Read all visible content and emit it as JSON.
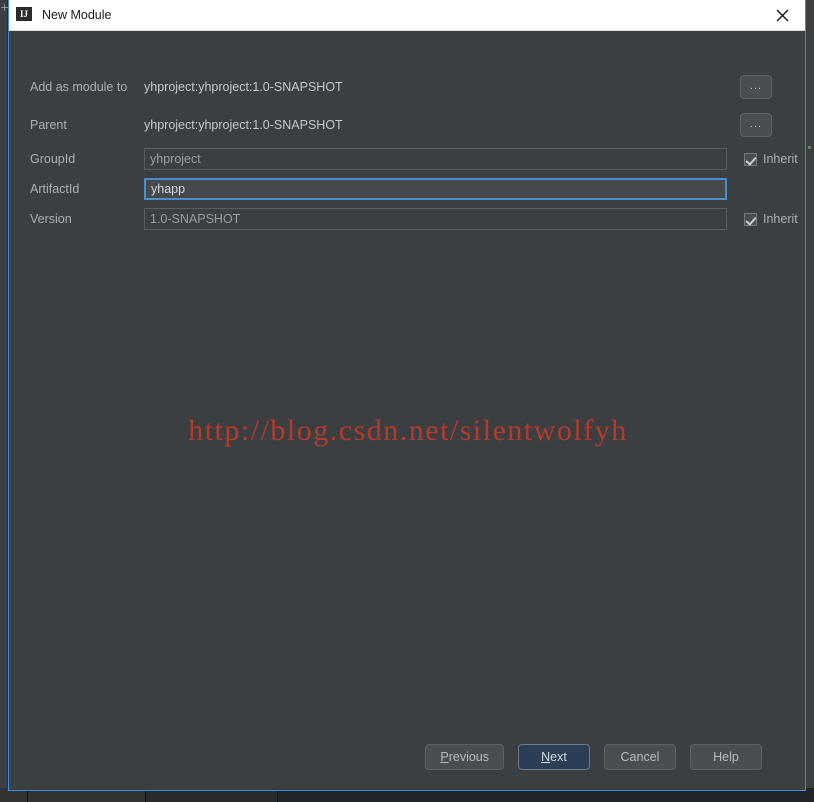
{
  "window": {
    "title": "New Module",
    "app_icon": "IJ",
    "close_icon": "close-icon"
  },
  "form": {
    "rows": [
      {
        "label": "Add as module to",
        "value": "yhproject:yhproject:1.0-SNAPSHOT",
        "browse_label": "..."
      },
      {
        "label": "Parent",
        "value": "yhproject:yhproject:1.0-SNAPSHOT",
        "browse_label": "..."
      }
    ],
    "fields": [
      {
        "label": "GroupId",
        "value": "yhproject",
        "inherit_label": "Inherit",
        "inherit_checked": true,
        "focused": false
      },
      {
        "label": "ArtifactId",
        "value": "yhapp",
        "inherit_label": "",
        "inherit_checked": false,
        "focused": true
      },
      {
        "label": "Version",
        "value": "1.0-SNAPSHOT",
        "inherit_label": "Inherit",
        "inherit_checked": true,
        "focused": false
      }
    ]
  },
  "watermark": {
    "text": "http://blog.csdn.net/silentwolfyh",
    "color": "#c0392b"
  },
  "buttons": {
    "previous": {
      "prefix": "P",
      "suffix": "revious"
    },
    "next": {
      "prefix": "N",
      "suffix": "ext"
    },
    "cancel": "Cancel",
    "help": "Help"
  },
  "colors": {
    "dialog_bg": "#3c3f41",
    "border_accent": "#3a8ee0",
    "field_focus": "#4b8ecb",
    "default_button_bg": "#2c3e55"
  }
}
